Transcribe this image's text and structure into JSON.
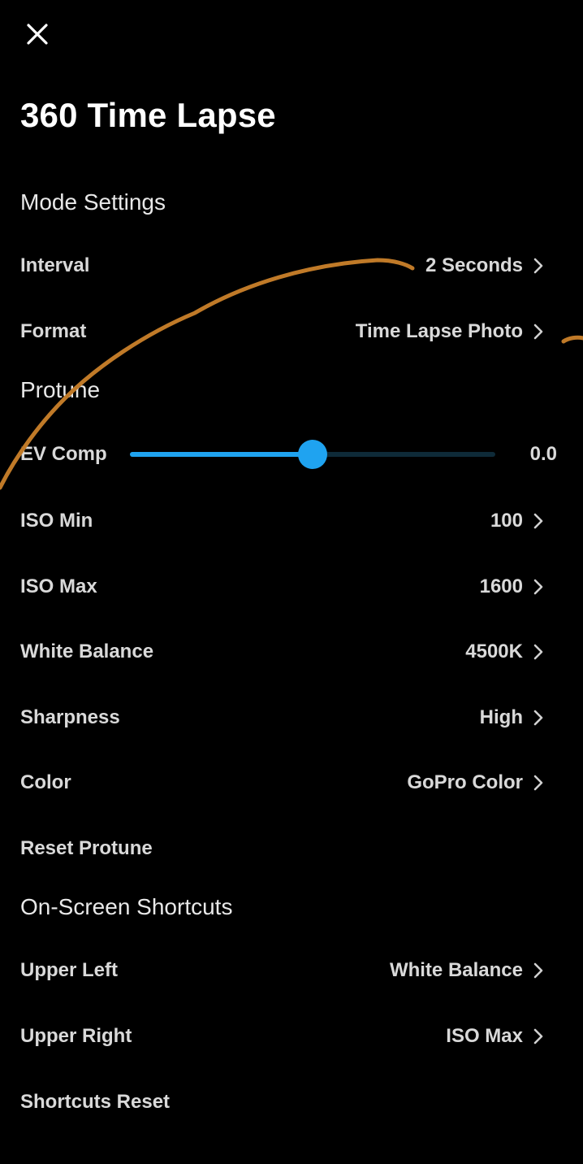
{
  "header": {
    "close_icon": "close-icon",
    "title": "360 Time Lapse"
  },
  "mode_settings": {
    "heading": "Mode Settings",
    "interval": {
      "label": "Interval",
      "value": "2 Seconds"
    },
    "format": {
      "label": "Format",
      "value": "Time Lapse Photo"
    }
  },
  "protune": {
    "heading": "Protune",
    "ev_comp": {
      "label": "EV Comp",
      "value": "0.0",
      "slider_position": 0.5
    },
    "iso_min": {
      "label": "ISO Min",
      "value": "100"
    },
    "iso_max": {
      "label": "ISO Max",
      "value": "1600"
    },
    "white_balance": {
      "label": "White Balance",
      "value": "4500K"
    },
    "sharpness": {
      "label": "Sharpness",
      "value": "High"
    },
    "color": {
      "label": "Color",
      "value": "GoPro Color"
    },
    "reset": {
      "label": "Reset Protune"
    }
  },
  "shortcuts": {
    "heading": "On-Screen Shortcuts",
    "upper_left": {
      "label": "Upper Left",
      "value": "White Balance"
    },
    "upper_right": {
      "label": "Upper Right",
      "value": "ISO Max"
    },
    "reset": {
      "label": "Shortcuts Reset"
    }
  },
  "colors": {
    "background": "#000000",
    "accent": "#1fa3f0",
    "annotation_stroke": "#c07a28"
  }
}
